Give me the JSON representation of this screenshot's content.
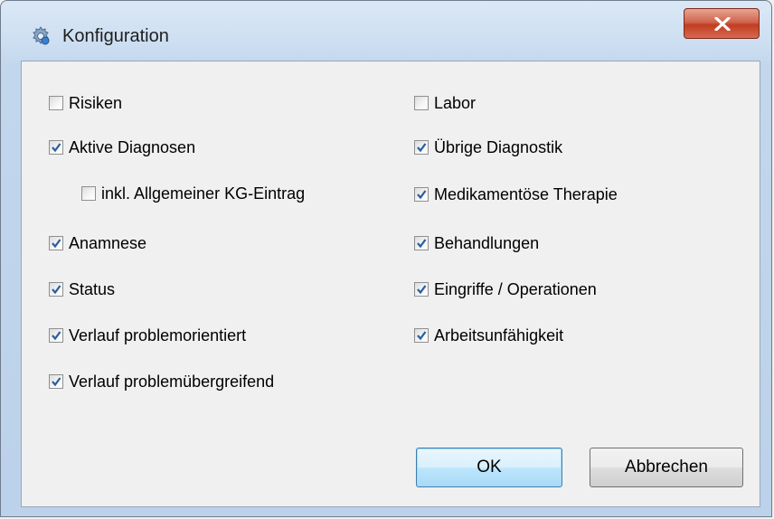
{
  "window": {
    "title": "Konfiguration",
    "icon": "gear-icon",
    "close_icon": "close-icon"
  },
  "checkboxes": {
    "left": [
      {
        "label": "Risiken",
        "checked": false
      },
      {
        "label": "Aktive Diagnosen",
        "checked": true
      },
      {
        "label": "inkl. Allgemeiner KG-Eintrag",
        "checked": false
      },
      {
        "label": "Anamnese",
        "checked": true
      },
      {
        "label": "Status",
        "checked": true
      },
      {
        "label": "Verlauf problemorientiert",
        "checked": true
      },
      {
        "label": "Verlauf problemübergreifend",
        "checked": true
      }
    ],
    "right": [
      {
        "label": "Labor",
        "checked": false
      },
      {
        "label": "Übrige Diagnostik",
        "checked": true
      },
      {
        "label": "Medikamentöse Therapie",
        "checked": true
      },
      {
        "label": "Behandlungen",
        "checked": true
      },
      {
        "label": "Eingriffe / Operationen",
        "checked": true
      },
      {
        "label": "Arbeitsunfähigkeit",
        "checked": true
      }
    ]
  },
  "buttons": {
    "ok_label": "OK",
    "cancel_label": "Abbrechen"
  },
  "colors": {
    "check_mark": "#2a5d9f",
    "close_button": "#c7462b",
    "default_button_border": "#3c7fb1"
  }
}
